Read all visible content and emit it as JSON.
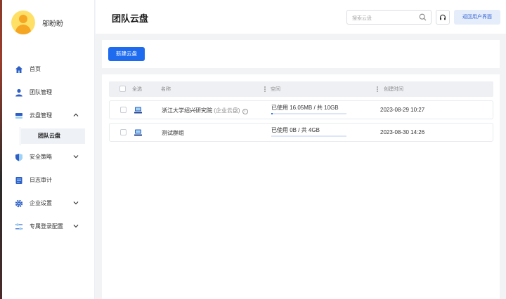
{
  "user": {
    "name": "邬盼盼"
  },
  "sidebar": {
    "items": [
      {
        "label": "首页",
        "icon": "home-icon",
        "has_chevron": false
      },
      {
        "label": "团队管理",
        "icon": "person-icon",
        "has_chevron": false
      },
      {
        "label": "云盘管理",
        "icon": "disk-icon",
        "has_chevron": true,
        "expanded": true
      },
      {
        "label": "安全策略",
        "icon": "shield-icon",
        "has_chevron": true
      },
      {
        "label": "日志审计",
        "icon": "log-icon",
        "has_chevron": false
      },
      {
        "label": "企业设置",
        "icon": "gear-icon",
        "has_chevron": true
      },
      {
        "label": "专属登录配置",
        "icon": "sliders-icon",
        "has_chevron": true
      }
    ],
    "sub_items": [
      {
        "label": "团队云盘",
        "active": true
      }
    ]
  },
  "header": {
    "title": "团队云盘",
    "search_placeholder": "搜索云盘",
    "return_label": "返回用户界面"
  },
  "toolbar": {
    "new_label": "新建云盘"
  },
  "table": {
    "headers": {
      "select_all": "全选",
      "name": "名称",
      "space": "空间",
      "created": "创建时间"
    },
    "rows": [
      {
        "name": "浙江大学绍兴研究院",
        "tag": "(企业云盘)",
        "show_info": true,
        "usage": "已使用 16.05MB / 共 10GB",
        "usage_fraction": 0.0016,
        "created": "2023-08-29 10:27"
      },
      {
        "name": "测试群组",
        "tag": "",
        "show_info": false,
        "usage": "已使用 0B / 共 4GB",
        "usage_fraction": 0,
        "created": "2023-08-30 14:26"
      }
    ]
  },
  "colors": {
    "accent": "#1e6bf0",
    "return_bg": "#e6edfa",
    "return_text": "#3b6ad8",
    "active_sub_bg": "#eef1f6"
  }
}
